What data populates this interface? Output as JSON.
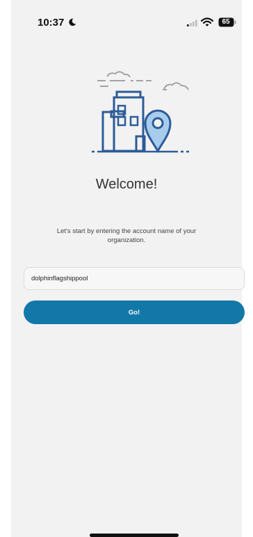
{
  "status_bar": {
    "time": "10:37",
    "battery": "65"
  },
  "login": {
    "title": "Welcome!",
    "instructions": "Let's start by entering the account name of your organization.",
    "account_value": "dolphinflagshippool",
    "go_label": "Go!"
  },
  "colors": {
    "accent": "#1378a8",
    "logo_blue": "#2c5c98",
    "logo_light_blue": "#a7ccec",
    "background": "#f2f2f2"
  },
  "icons": [
    "moon-icon",
    "signal-icon",
    "wifi-icon",
    "battery-icon",
    "building-location-logo"
  ]
}
